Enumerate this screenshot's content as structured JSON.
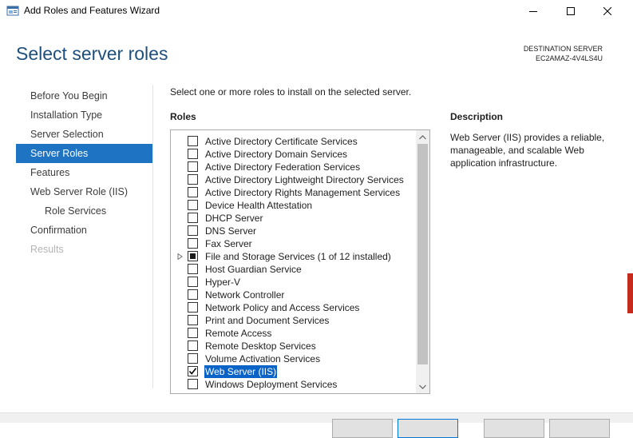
{
  "window": {
    "title": "Add Roles and Features Wizard",
    "controls": [
      "minimize-icon",
      "maximize-icon",
      "close-icon"
    ]
  },
  "page": {
    "heading": "Select server roles",
    "destination_label": "DESTINATION SERVER",
    "destination_value": "EC2AMAZ-4V4LS4U"
  },
  "nav": {
    "items": [
      {
        "label": "Before You Begin",
        "state": "normal"
      },
      {
        "label": "Installation Type",
        "state": "normal"
      },
      {
        "label": "Server Selection",
        "state": "normal"
      },
      {
        "label": "Server Roles",
        "state": "active"
      },
      {
        "label": "Features",
        "state": "normal"
      },
      {
        "label": "Web Server Role (IIS)",
        "state": "normal"
      },
      {
        "label": "Role Services",
        "state": "sub"
      },
      {
        "label": "Confirmation",
        "state": "normal"
      },
      {
        "label": "Results",
        "state": "disabled"
      }
    ]
  },
  "main": {
    "instruction": "Select one or more roles to install on the selected server.",
    "roles_label": "Roles",
    "description_label": "Description",
    "description_text": "Web Server (IIS) provides a reliable, manageable, and scalable Web application infrastructure."
  },
  "roles": [
    {
      "label": "Active Directory Certificate Services",
      "checked": false
    },
    {
      "label": "Active Directory Domain Services",
      "checked": false
    },
    {
      "label": "Active Directory Federation Services",
      "checked": false
    },
    {
      "label": "Active Directory Lightweight Directory Services",
      "checked": false
    },
    {
      "label": "Active Directory Rights Management Services",
      "checked": false
    },
    {
      "label": "Device Health Attestation",
      "checked": false
    },
    {
      "label": "DHCP Server",
      "checked": false
    },
    {
      "label": "DNS Server",
      "checked": false
    },
    {
      "label": "Fax Server",
      "checked": false
    },
    {
      "label": "File and Storage Services (1 of 12 installed)",
      "checked": "partial",
      "expandable": true
    },
    {
      "label": "Host Guardian Service",
      "checked": false
    },
    {
      "label": "Hyper-V",
      "checked": false
    },
    {
      "label": "Network Controller",
      "checked": false
    },
    {
      "label": "Network Policy and Access Services",
      "checked": false
    },
    {
      "label": "Print and Document Services",
      "checked": false
    },
    {
      "label": "Remote Access",
      "checked": false
    },
    {
      "label": "Remote Desktop Services",
      "checked": false
    },
    {
      "label": "Volume Activation Services",
      "checked": false
    },
    {
      "label": "Web Server (IIS)",
      "checked": true,
      "selected": true
    },
    {
      "label": "Windows Deployment Services",
      "checked": false
    }
  ],
  "colors": {
    "heading": "#1e4f7c",
    "nav_active_bg": "#1e73c2",
    "selection_bg": "#0a64c8"
  }
}
